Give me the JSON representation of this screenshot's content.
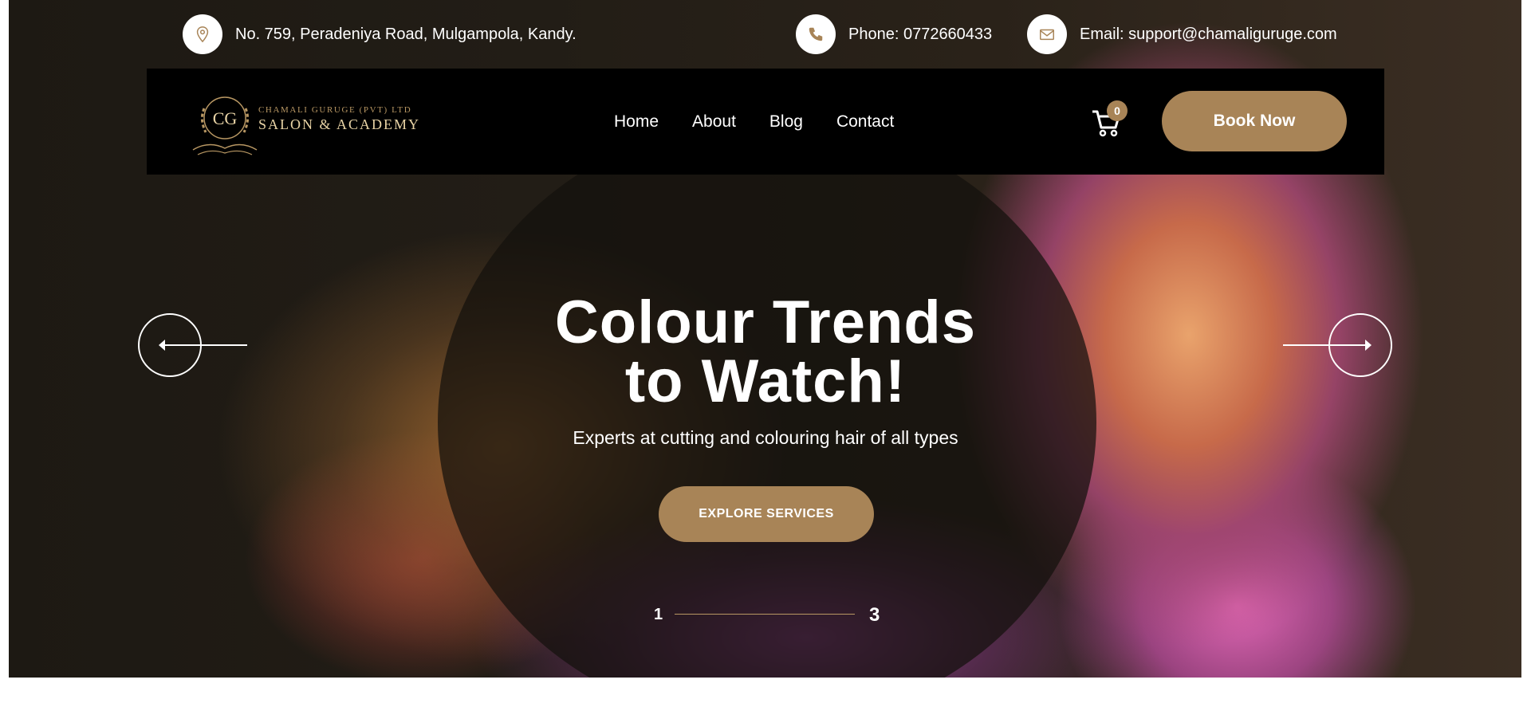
{
  "topbar": {
    "address": {
      "icon": "location-pin-icon",
      "text": "No. 759, Peradeniya Road, Mulgampola, Kandy."
    },
    "phone": {
      "icon": "phone-icon",
      "text": "Phone: 0772660433"
    },
    "email": {
      "icon": "envelope-icon",
      "text": "Email: support@chamaliguruge.com"
    }
  },
  "logo": {
    "monogram": "CG",
    "line1": "CHAMALI GURUGE (PVT) LTD",
    "line2": "SALON & ACADEMY"
  },
  "nav": {
    "items": [
      {
        "label": "Home"
      },
      {
        "label": "About"
      },
      {
        "label": "Blog"
      },
      {
        "label": "Contact"
      }
    ],
    "cart_count": "0",
    "book_label": "Book Now"
  },
  "hero": {
    "title_line1": "Colour Trends",
    "title_line2": "to Watch!",
    "subtitle": "Experts at cutting and colouring hair of all types",
    "cta_label": "EXPLORE SERVICES",
    "pager_start": "1",
    "pager_end": "3"
  },
  "colors": {
    "accent": "#a88457",
    "logo_gold": "#b89763",
    "nav_bg": "#000000"
  }
}
